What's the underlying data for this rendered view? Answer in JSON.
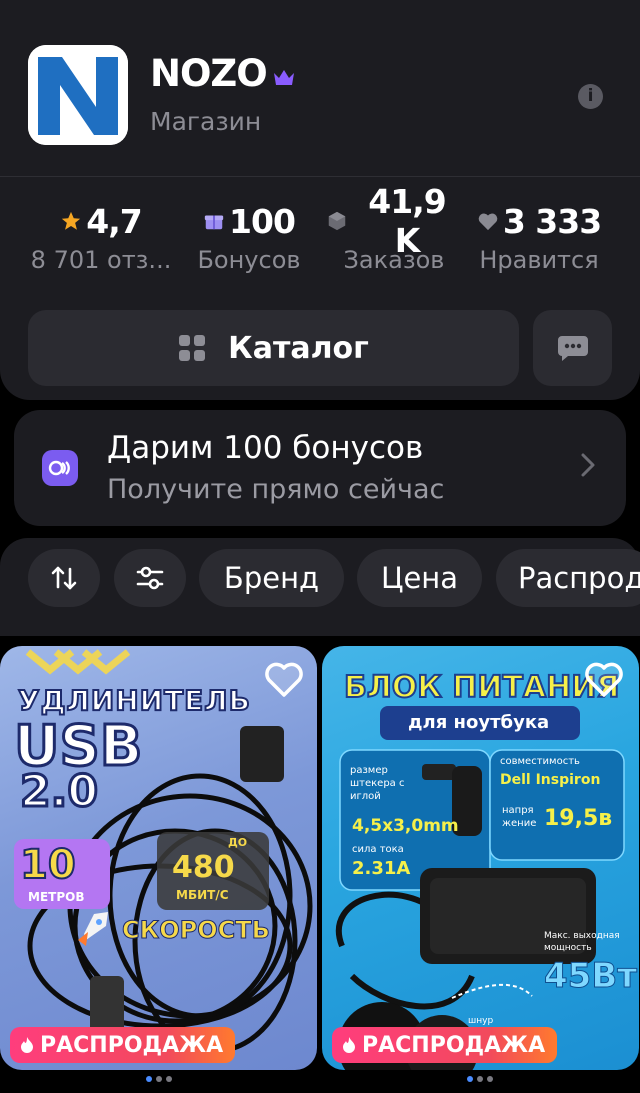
{
  "shop": {
    "name": "NOZO",
    "type": "Магазин"
  },
  "stats": [
    {
      "value": "4,7",
      "label": "8 701 отз...",
      "icon": "star-icon"
    },
    {
      "value": "100",
      "label": "Бонусов",
      "icon": "gift-icon"
    },
    {
      "value": "41,9 K",
      "label": "Заказов",
      "icon": "box-icon"
    },
    {
      "value": "3 333",
      "label": "Нравится",
      "icon": "heart-icon"
    }
  ],
  "catalog_label": "Каталог",
  "promo": {
    "title": "Дарим 100 бонусов",
    "subtitle": "Получите прямо сейчас"
  },
  "filters": {
    "brand": "Бренд",
    "price": "Цена",
    "sale": "Распрод"
  },
  "products": [
    {
      "badge": "РАСПРОДАЖА",
      "text": {
        "l1": "УДЛИНИТЕЛЬ",
        "l2": "USB",
        "l3": "2.0",
        "length_value": "10",
        "length_unit": "МЕТРОВ",
        "speed_prefix": "ДО",
        "speed_value": "480",
        "speed_unit": "МБИТ/С",
        "speed_label": "СКОРОСТЬ"
      }
    },
    {
      "badge": "РАСПРОДАЖА",
      "text": {
        "title": "БЛОК ПИТАНИЯ",
        "subtitle": "для ноутбука",
        "plug_label": "размер штекера с иглой",
        "plug_value": "4,5x3,0mm",
        "current_label": "сила тока",
        "current_value": "2.31A",
        "compat_label": "совместимость",
        "compat_value": "Dell Inspiron",
        "voltage_label": "напря жение",
        "voltage_value": "19,5в",
        "power_label": "Макс. выходная мощность",
        "power_value": "45Вт",
        "cord_label": "шнур"
      }
    }
  ],
  "colors": {
    "background": "#000000",
    "card": "#1c1c21",
    "chip": "#2b2b31",
    "accent": "#7b5cf0",
    "star": "#f5a623",
    "sale_gradient_start": "#ff3d7d"
  }
}
